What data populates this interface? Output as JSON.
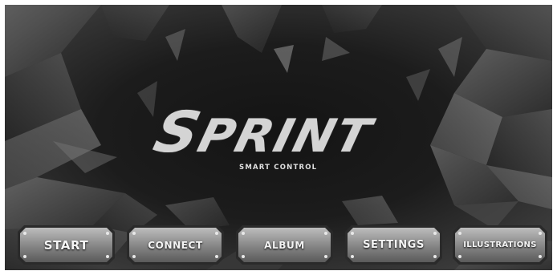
{
  "app": {
    "logo_text": "SPRINT",
    "logo_subtitle": "SMART CONTROL"
  },
  "menu": [
    {
      "id": "start",
      "label": "START"
    },
    {
      "id": "connect",
      "label": "CONNECT"
    },
    {
      "id": "album",
      "label": "ALBUM"
    },
    {
      "id": "settings",
      "label": "SETTINGS"
    },
    {
      "id": "illustrations",
      "label": "ILLUSTRATIONS"
    }
  ],
  "colors": {
    "background": "#1e1e1e",
    "shard_light": "#5e5e5e",
    "shard_dark": "#2e2e2e",
    "button_face": "#8a8a8a",
    "logo": "#d4d4d4"
  }
}
